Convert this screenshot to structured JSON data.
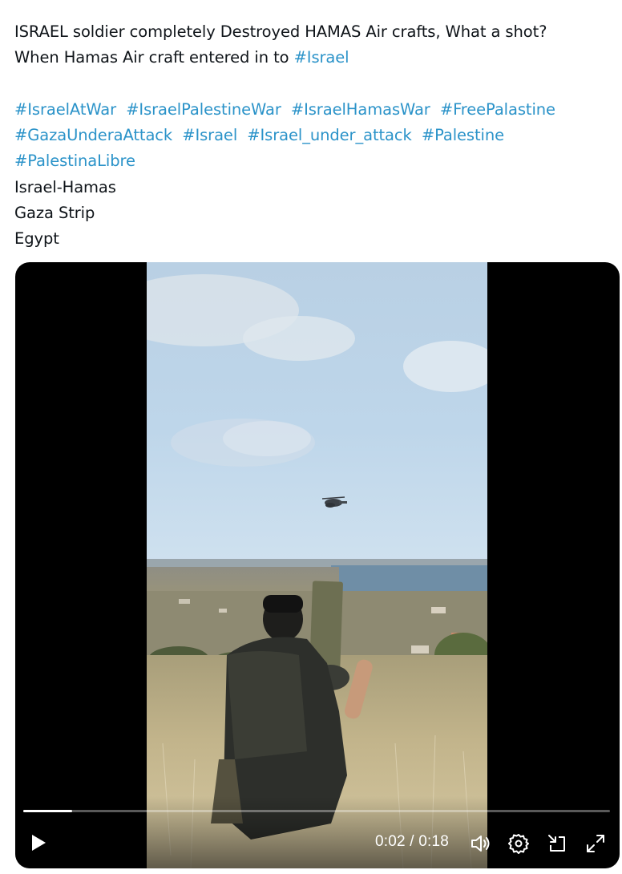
{
  "tweet": {
    "lines": {
      "l1": "ISRAEL soldier completely Destroyed HAMAS Air crafts, What a shot?",
      "l2_text": "When Hamas Air craft entered in to ",
      "l2_tag": "#Israel"
    },
    "hashtags_row1": [
      "#IsraelAtWar",
      "#IsraelPalestineWar",
      "#IsraelHamasWar",
      "#FreePalastine"
    ],
    "hashtags_row2": [
      "#GazaUnderaAttack",
      "#Israel",
      "#Israel_under_attack",
      "#Palestine"
    ],
    "hashtags_row3": [
      "#PalestinaLibre"
    ],
    "topics": [
      "Israel-Hamas",
      "Gaza Strip",
      "Egypt"
    ]
  },
  "video": {
    "current_time": "0:02",
    "duration": "0:18",
    "time_display": "0:02 / 0:18",
    "progress_fraction": 0.084,
    "controls": {
      "play_icon": "play-icon",
      "volume_icon": "volume-icon",
      "settings_icon": "settings-gear-icon",
      "popout_icon": "popout-icon",
      "fullscreen_icon": "fullscreen-expand-icon"
    }
  },
  "colors": {
    "text": "#0f1419",
    "hashtag": "#2b93c9",
    "media_background": "#000000"
  }
}
